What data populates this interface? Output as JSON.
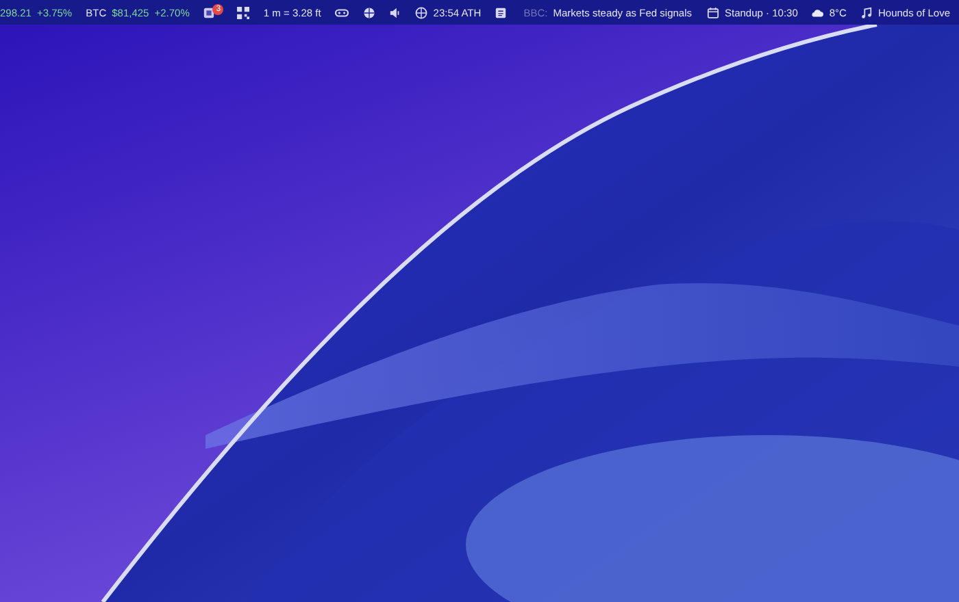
{
  "top_bar": {
    "tickers": [
      {
        "price": "298.21",
        "change": "+3.75%"
      },
      {
        "symbol": "BTC",
        "price": "$81,425",
        "change": "+2.70%"
      }
    ],
    "notifications": {
      "badge": "3"
    },
    "conversion": "1 m = 3.28 ft",
    "clock": "23:54 ATH",
    "news": {
      "source": "BBC:",
      "headline": "Markets steady as Fed signals"
    },
    "calendar": "Standup · 10:30",
    "weather": "8°C",
    "music": "Hounds of Love"
  }
}
